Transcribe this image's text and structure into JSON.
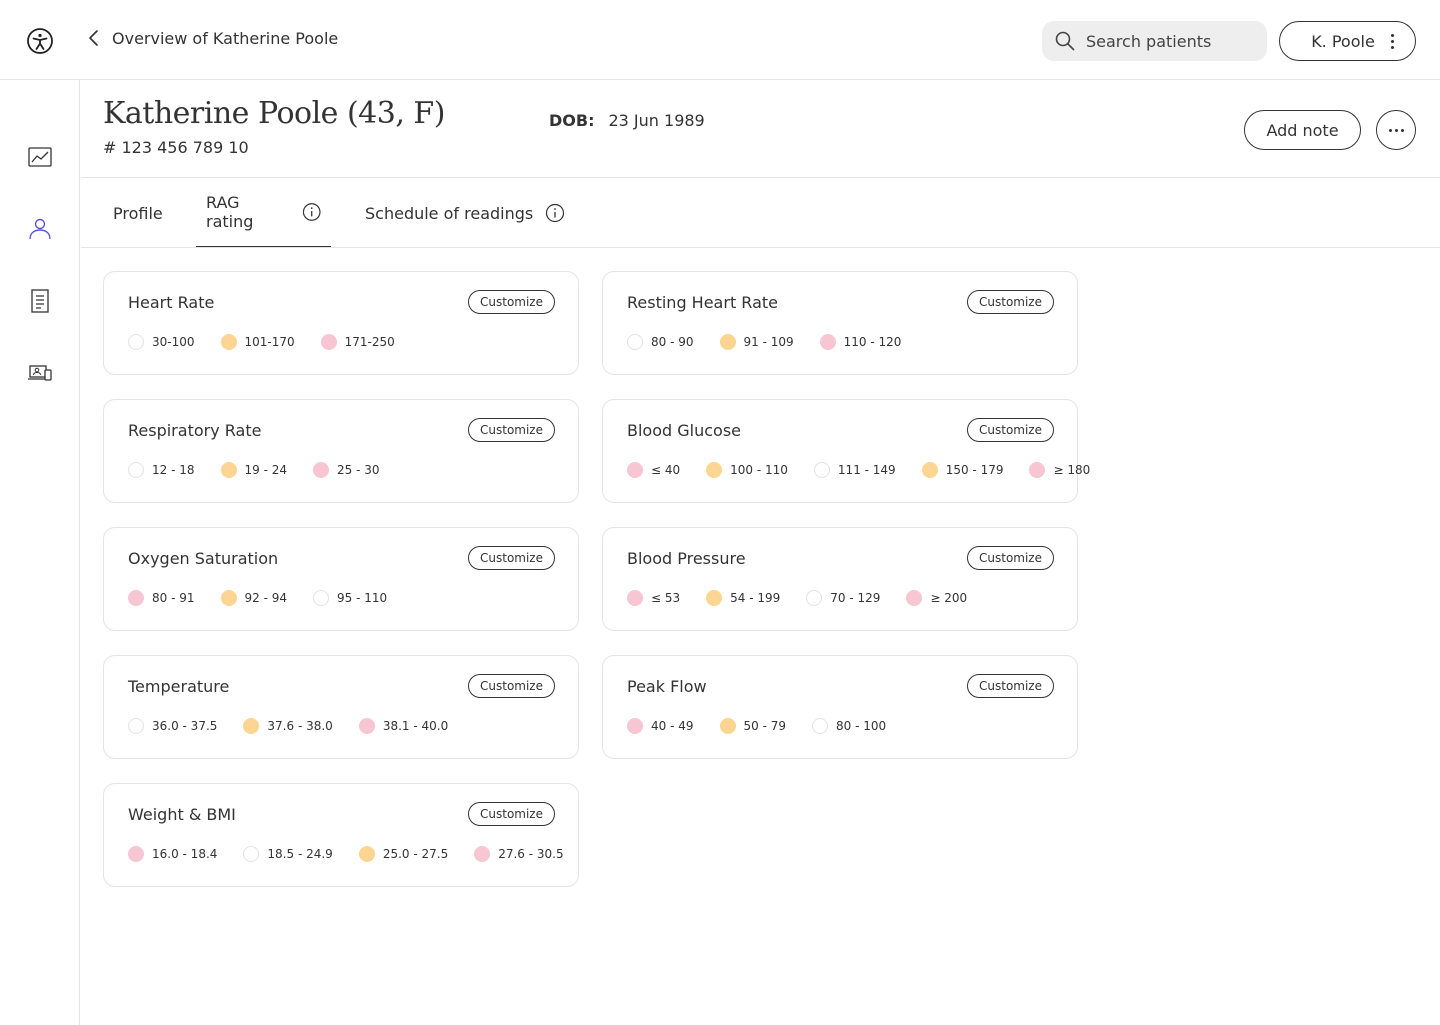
{
  "topbar": {
    "back_label": "Overview of Katherine Poole",
    "search_placeholder": "Search patients",
    "user_label": "K. Poole"
  },
  "sidebar": {
    "items": [
      {
        "icon": "chart-icon"
      },
      {
        "icon": "person-icon",
        "active": true
      },
      {
        "icon": "document-icon"
      },
      {
        "icon": "devices-icon"
      }
    ]
  },
  "patient": {
    "name": "Katherine Poole (43, F)",
    "id": "# 123 456 789 10",
    "dob_label": "DOB:",
    "dob_value": "23 Jun 1989",
    "add_note_label": "Add note"
  },
  "tabs": [
    {
      "label": "Profile"
    },
    {
      "label": "RAG rating",
      "active": true
    },
    {
      "label": "Schedule of readings"
    }
  ],
  "colors": {
    "green": "#ffffff",
    "amber": "#fdd592",
    "red": "#f8c6d2"
  },
  "customize_label": "Customize",
  "cards": [
    {
      "title": "Heart Rate",
      "ranges": [
        {
          "status": "green",
          "label": "30-100"
        },
        {
          "status": "amber",
          "label": "101-170"
        },
        {
          "status": "red",
          "label": "171-250"
        }
      ]
    },
    {
      "title": "Resting Heart Rate",
      "ranges": [
        {
          "status": "green",
          "label": "80 - 90"
        },
        {
          "status": "amber",
          "label": "91 - 109"
        },
        {
          "status": "red",
          "label": "110 - 120"
        }
      ]
    },
    {
      "title": "Respiratory Rate",
      "ranges": [
        {
          "status": "green",
          "label": "12 - 18"
        },
        {
          "status": "amber",
          "label": "19 - 24"
        },
        {
          "status": "red",
          "label": "25 - 30"
        }
      ]
    },
    {
      "title": "Blood Glucose",
      "ranges": [
        {
          "status": "red",
          "label": "≤ 40"
        },
        {
          "status": "amber",
          "label": "100 - 110"
        },
        {
          "status": "green",
          "label": "111 - 149"
        },
        {
          "status": "amber",
          "label": "150 - 179"
        },
        {
          "status": "red",
          "label": "≥ 180"
        }
      ]
    },
    {
      "title": "Oxygen Saturation",
      "ranges": [
        {
          "status": "red",
          "label": "80 - 91"
        },
        {
          "status": "amber",
          "label": "92 - 94"
        },
        {
          "status": "green",
          "label": "95 - 110"
        }
      ]
    },
    {
      "title": "Blood Pressure",
      "ranges": [
        {
          "status": "red",
          "label": "≤ 53"
        },
        {
          "status": "amber",
          "label": "54 - 199"
        },
        {
          "status": "green",
          "label": "70 - 129"
        },
        {
          "status": "red",
          "label": "≥ 200"
        }
      ]
    },
    {
      "title": "Temperature",
      "ranges": [
        {
          "status": "green",
          "label": "36.0 - 37.5"
        },
        {
          "status": "amber",
          "label": "37.6 - 38.0"
        },
        {
          "status": "red",
          "label": "38.1 - 40.0"
        }
      ]
    },
    {
      "title": "Peak Flow",
      "ranges": [
        {
          "status": "red",
          "label": "40 - 49"
        },
        {
          "status": "amber",
          "label": "50 - 79"
        },
        {
          "status": "green",
          "label": "80 - 100"
        }
      ]
    },
    {
      "title": "Weight & BMI",
      "ranges": [
        {
          "status": "red",
          "label": "16.0 - 18.4"
        },
        {
          "status": "green",
          "label": "18.5 - 24.9"
        },
        {
          "status": "amber",
          "label": "25.0 - 27.5"
        },
        {
          "status": "red",
          "label": "27.6 - 30.5"
        }
      ]
    }
  ]
}
